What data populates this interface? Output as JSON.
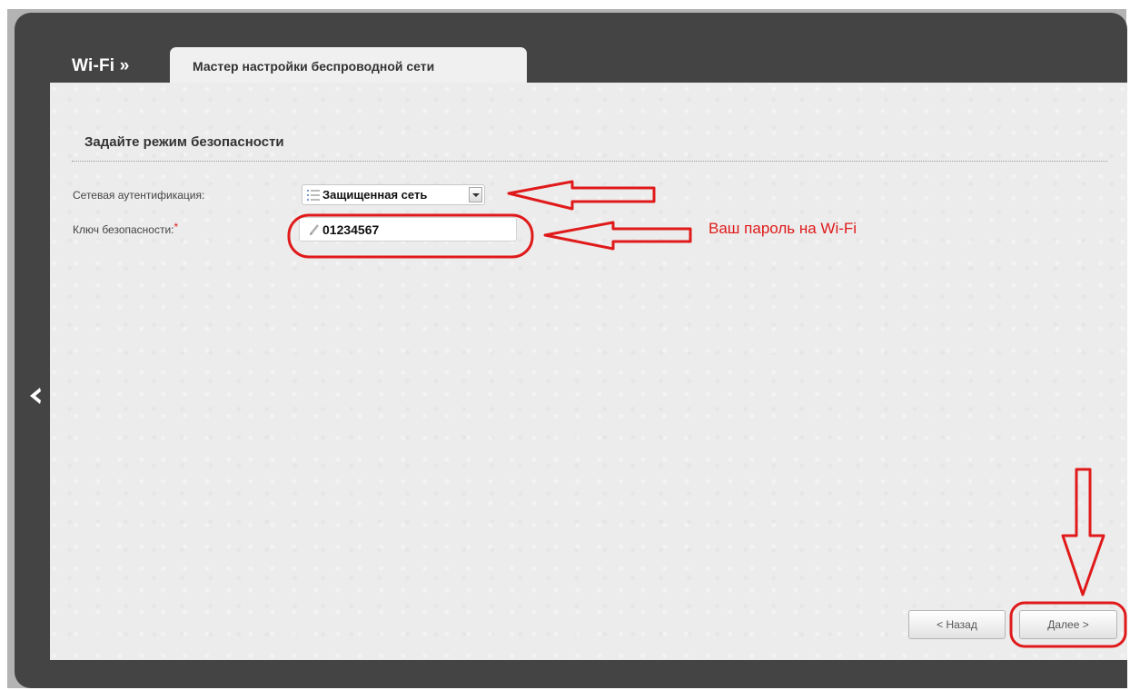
{
  "header": {
    "section_title": "Wi-Fi »",
    "tab_label": "Мастер настройки беспроводной сети"
  },
  "form": {
    "heading": "Задайте режим безопасности",
    "auth_label": "Сетевая аутентификация:",
    "auth_value": "Защищенная сеть",
    "key_label": "Ключ безопасности:",
    "key_required_mark": "*",
    "key_value": "01234567"
  },
  "buttons": {
    "back": "< Назад",
    "next": "Далее >"
  },
  "annotation": {
    "password_hint": "Ваш пароль на Wi-Fi",
    "color": "#e01a1a"
  },
  "icons": {
    "sidebar_toggle": "chevron-left-icon",
    "select_prefix": "list-icon",
    "field_prefix": "pencil-icon"
  },
  "colors": {
    "dark_panel": "#444444",
    "content_bg": "#ececec",
    "annotation": "#e01a1a"
  }
}
